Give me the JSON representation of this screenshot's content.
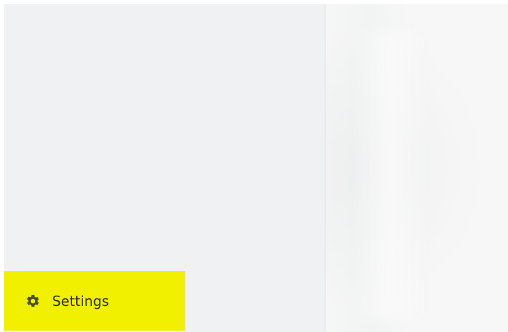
{
  "sidebar": {
    "settings_item": {
      "label": "Settings",
      "icon": "gear-icon"
    }
  },
  "colors": {
    "sidebar_bg": "#f0f1f3",
    "highlight": "#f0f000",
    "text": "#2b2f2b",
    "icon": "#4a4f3a"
  }
}
